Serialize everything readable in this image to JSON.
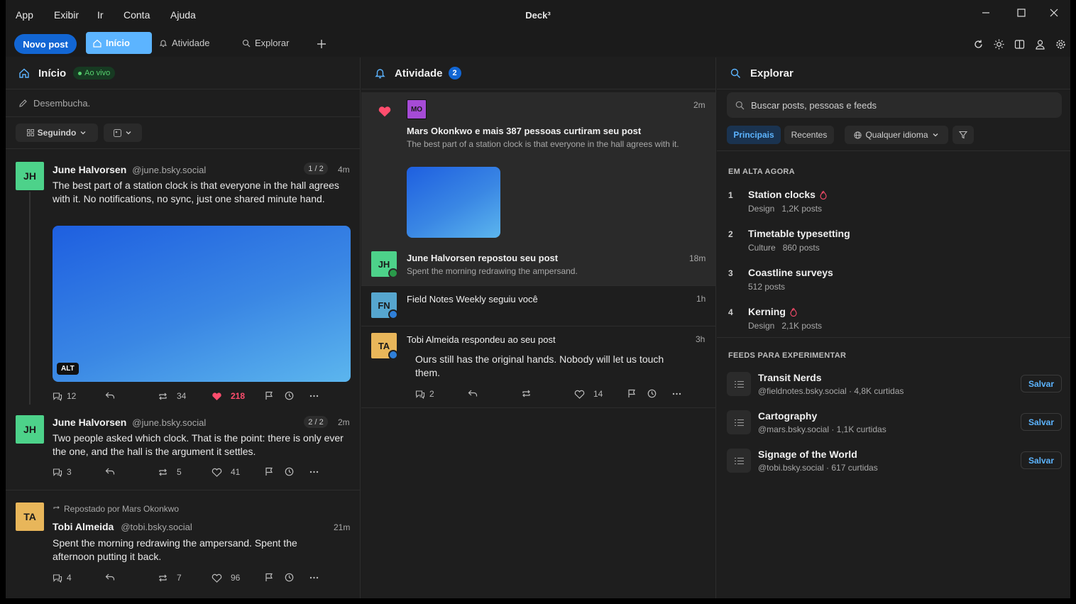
{
  "app": {
    "title": "Deck³",
    "menu": [
      "App",
      "Exibir",
      "Ir",
      "Conta",
      "Ajuda"
    ]
  },
  "toolbar": {
    "new_post": "Novo post",
    "tabs": [
      "Início",
      "Atividade",
      "Explorar"
    ]
  },
  "colors": {
    "accent": "#1266d4",
    "tab_active": "#5cb4ff",
    "like": "#ff4d6d",
    "live": "#57d26f"
  },
  "home": {
    "title": "Início",
    "live": "Ao vivo",
    "composer_placeholder": "Desembucha.",
    "filter_following": "Seguindo",
    "posts": [
      {
        "initials": "JH",
        "name": "June Halvorsen",
        "handle": "@june.bsky.social",
        "thread": "1 / 2",
        "time": "4m",
        "text": "The best part of a station clock is that everyone in the hall agrees with it. No notifications, no sync, just one shared minute hand.",
        "alt": "ALT",
        "replies": "12",
        "reposts": "34",
        "likes": "218"
      },
      {
        "initials": "JH",
        "name": "June Halvorsen",
        "handle": "@june.bsky.social",
        "thread": "2 / 2",
        "time": "2m",
        "text": "Two people asked which clock. That is the point: there is only ever the one, and the hall is the argument it settles.",
        "replies": "3",
        "reposts": "5",
        "likes": "41"
      },
      {
        "initials": "TA",
        "repost_by": "Repostado por Mars Okonkwo",
        "name": "Tobi Almeida",
        "handle": "@tobi.bsky.social",
        "time": "21m",
        "text": "Spent the morning redrawing the ampersand. Spent the afternoon putting it back.",
        "replies": "4",
        "reposts": "7",
        "likes": "96"
      }
    ]
  },
  "activity": {
    "title": "Atividade",
    "count": "2",
    "items": [
      {
        "initials": "MO",
        "title": "Mars Okonkwo e mais 387 pessoas curtiram seu post",
        "sub": "The best part of a station clock is that everyone in the hall agrees with it.",
        "time": "2m"
      },
      {
        "initials": "JH",
        "title": "June Halvorsen repostou seu post",
        "sub": "Spent the morning redrawing the ampersand.",
        "time": "18m"
      },
      {
        "initials": "FN",
        "title": "Field Notes Weekly seguiu você",
        "time": "1h"
      },
      {
        "initials": "TA",
        "title": "Tobi Almeida respondeu ao seu post",
        "body": "Ours still has the original hands. Nobody will let us touch them.",
        "time": "3h",
        "replies": "2",
        "likes": "14"
      }
    ]
  },
  "explore": {
    "title": "Explorar",
    "search_placeholder": "Buscar posts, pessoas e feeds",
    "filters": [
      "Principais",
      "Recentes",
      "Qualquer idioma"
    ],
    "trending_label": "EM ALTA AGORA",
    "trending": [
      {
        "rank": "1",
        "title": "Station clocks",
        "hot": true,
        "category": "Design",
        "posts": "1,2K posts"
      },
      {
        "rank": "2",
        "title": "Timetable typesetting",
        "hot": false,
        "category": "Culture",
        "posts": "860 posts"
      },
      {
        "rank": "3",
        "title": "Coastline surveys",
        "hot": false,
        "category": "",
        "posts": "512 posts"
      },
      {
        "rank": "4",
        "title": "Kerning",
        "hot": true,
        "category": "Design",
        "posts": "2,1K posts"
      }
    ],
    "feeds_label": "FEEDS PARA EXPERIMENTAR",
    "feeds": [
      {
        "title": "Transit Nerds",
        "handle": "@fieldnotes.bsky.social",
        "likes": "· 4,8K curtidas",
        "save": "Salvar"
      },
      {
        "title": "Cartography",
        "handle": "@mars.bsky.social",
        "likes": "· 1,1K curtidas",
        "save": "Salvar"
      },
      {
        "title": "Signage of the World",
        "handle": "@tobi.bsky.social",
        "likes": "· 617 curtidas",
        "save": "Salvar"
      }
    ]
  }
}
